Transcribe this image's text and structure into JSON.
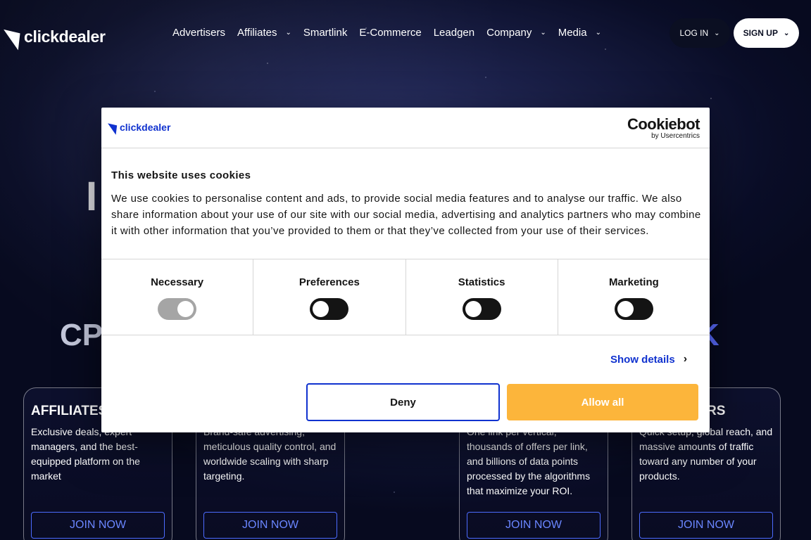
{
  "header": {
    "logo_text": "clickdealer",
    "nav": [
      {
        "label": "Advertisers",
        "dropdown": false
      },
      {
        "label": "Affiliates",
        "dropdown": true
      },
      {
        "label": "Smartlink",
        "dropdown": false
      },
      {
        "label": "E-Commerce",
        "dropdown": false
      },
      {
        "label": "Leadgen",
        "dropdown": false
      },
      {
        "label": "Company",
        "dropdown": true
      },
      {
        "label": "Media",
        "dropdown": true
      }
    ],
    "login_label": "LOG IN",
    "signup_label": "SIGN UP"
  },
  "hero": {
    "line1_fragment": "I",
    "line2_fragment": "CP",
    "line3_fragment": "K"
  },
  "cards": [
    {
      "title": "AFFILIATES",
      "desc": "Exclusive deals, expert managers, and the best-equipped platform on the market",
      "button": "JOIN NOW"
    },
    {
      "title": "",
      "desc": "Brand-safe advertising, meticulous quality control, and worldwide scaling with sharp targeting.",
      "button": "JOIN NOW"
    },
    {
      "title": "",
      "desc": "One link per vertical, thousands of offers per link, and billions of data points processed by the algorithms that maximize your ROI.",
      "button": "JOIN NOW"
    },
    {
      "title": "RS",
      "desc": "Quick setup, global reach, and massive amounts of traffic toward any number of your products.",
      "button": "JOIN NOW"
    }
  ],
  "cookie_dialog": {
    "logo_text": "clickdealer",
    "provider_name": "Cookiebot",
    "provider_by": "by Usercentrics",
    "title": "This website uses cookies",
    "text": "We use cookies to personalise content and ads, to provide social media features and to analyse our traffic. We also share information about your use of our site with our social media, advertising and analytics partners who may combine it with other information that you’ve provided to them or that they’ve collected from your use of their services.",
    "toggles": [
      {
        "label": "Necessary",
        "enabled": true,
        "disabled": true
      },
      {
        "label": "Preferences",
        "enabled": false,
        "disabled": false
      },
      {
        "label": "Statistics",
        "enabled": false,
        "disabled": false
      },
      {
        "label": "Marketing",
        "enabled": false,
        "disabled": false
      }
    ],
    "show_details_label": "Show details",
    "deny_label": "Deny",
    "allow_label": "Allow all",
    "colors": {
      "accent": "#1032cf",
      "allow": "#fcb53b"
    }
  }
}
